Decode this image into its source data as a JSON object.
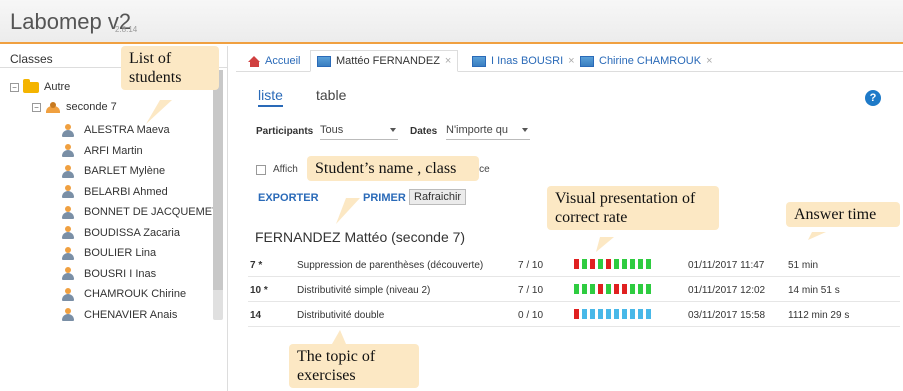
{
  "app": {
    "name": "Labomep v2",
    "version": "2.8.14"
  },
  "left_panel": {
    "header": "Classes",
    "folder": "Autre",
    "class_name": "seconde 7",
    "students": [
      "ALESTRA Maeva",
      "ARFI Martin",
      "BARLET Mylène",
      "BELARBI Ahmed",
      "BONNET DE JACQUEMET",
      "BOUDISSA Zacaria",
      "BOULIER Lina",
      "BOUSRI I Inas",
      "CHAMROUK Chirine",
      "CHENAVIER Anais"
    ]
  },
  "tabs": [
    "Accueil",
    "Mattéo FERNANDEZ",
    "I Inas BOUSRI",
    "Chirine CHAMROUK"
  ],
  "subtabs": {
    "list": "liste",
    "table": "table"
  },
  "filters": {
    "participants_label": "Participants",
    "participants_value": "Tous",
    "dates_label": "Dates",
    "dates_value": "N'importe qu"
  },
  "checkbox_text_left": "Affich",
  "checkbox_text_right": "ence",
  "actions": {
    "export": "EXPORTER",
    "print": "PRIMER",
    "refresh": "Rafraichir"
  },
  "student_heading": "FERNANDEZ Mattéo (seconde 7)",
  "results": [
    {
      "index": "7 *",
      "topic": "Suppression de parenthèses (découverte)",
      "score": "7 / 10",
      "date": "01/11/2017 11:47",
      "time": "51 min",
      "cells": [
        "r",
        "g",
        "r",
        "g",
        "r",
        "g",
        "g",
        "g",
        "g",
        "g"
      ]
    },
    {
      "index": "10 *",
      "topic": "Distributivité simple (niveau 2)",
      "score": "7 / 10",
      "date": "01/11/2017 12:02",
      "time": "14 min 51 s",
      "cells": [
        "g",
        "g",
        "g",
        "r",
        "g",
        "r",
        "r",
        "g",
        "g",
        "g"
      ]
    },
    {
      "index": "14",
      "topic": "Distributivité double",
      "score": "0 / 10",
      "date": "03/11/2017 15:58",
      "time": "1112 min 29 s",
      "cells": [
        "r",
        "b",
        "b",
        "b",
        "b",
        "b",
        "b",
        "b",
        "b",
        "b"
      ]
    }
  ],
  "colors": {
    "correct": "#2ecc40",
    "wrong": "#e02020",
    "unanswered": "#48b8e8",
    "accent": "#f0a040",
    "link": "#2a6ab8"
  },
  "annotations": {
    "list_of_students": "List of students",
    "student_name": "Student’s name , class",
    "visual_presentation": "Visual presentation of correct rate",
    "answer_time": "Answer time",
    "topic": "The topic of exercises"
  }
}
